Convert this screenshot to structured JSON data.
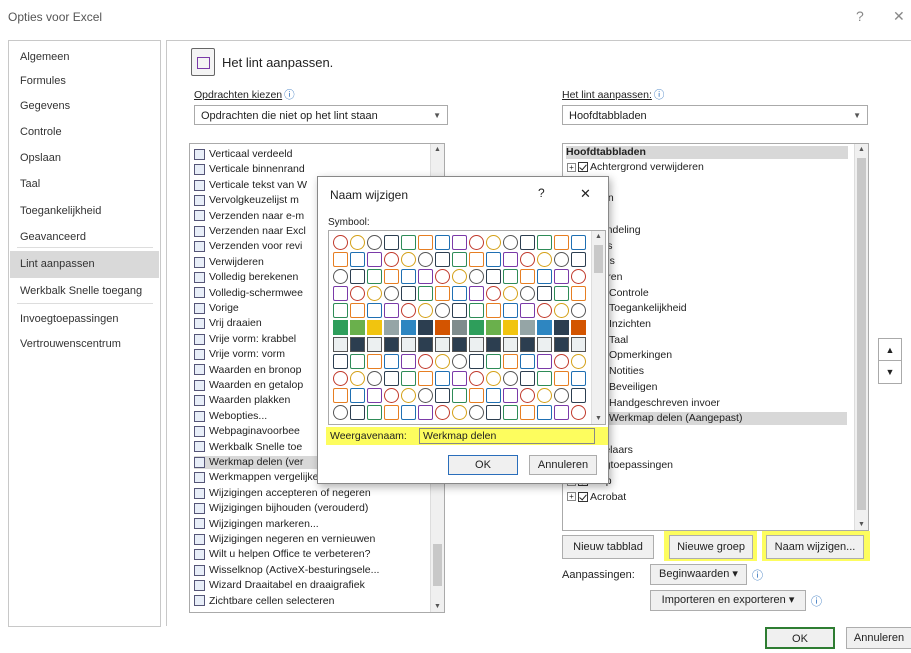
{
  "window": {
    "title": "Opties voor Excel",
    "help": "?",
    "close": "✕"
  },
  "nav": {
    "items": [
      "Algemeen",
      "Formules",
      "Gegevens",
      "Controle",
      "Opslaan",
      "Taal",
      "Toegankelijkheid",
      "Geavanceerd",
      "Lint aanpassen",
      "Werkbalk Snelle toegang",
      "Invoegtoepassingen",
      "Vertrouwenscentrum"
    ],
    "selected": "Lint aanpassen"
  },
  "header": {
    "title": "Het lint aanpassen."
  },
  "left": {
    "label": "Opdrachten kiezen",
    "dropdown_value": "Opdrachten die niet op het lint staan",
    "items": [
      "Verticaal verdeeld",
      "Verticale binnenrand",
      "Verticale tekst van W",
      "Vervolgkeuzelijst m",
      "Verzenden naar e-m",
      "Verzenden naar Excl",
      "Verzenden voor revi",
      "Verwijderen",
      "Volledig berekenen",
      "Volledig-schermwee",
      "Vorige",
      "Vrij draaien",
      "Vrije vorm: krabbel",
      "Vrije vorm: vorm",
      "Waarden en bronop",
      "Waarden en getalop",
      "Waarden plakken",
      "Webopties...",
      "Webpaginavoorbee",
      "Werkbalk Snelle toe",
      "Werkmap delen (ver",
      "Werkmappen vergelijken en samenv",
      "Wijzigingen accepteren of negeren",
      "Wijzigingen bijhouden (verouderd)",
      "Wijzigingen markeren...",
      "Wijzigingen negeren en vernieuwen",
      "Wilt u helpen Office te verbeteren?",
      "Wisselknop (ActiveX-besturingsele...",
      "Wizard Draaitabel en draaigrafiek",
      "Zichtbare cellen selecteren"
    ]
  },
  "right": {
    "label": "Het lint aanpassen:",
    "dropdown_value": "Hoofdtabbladen",
    "tree_header": "Hoofdtabbladen",
    "items": [
      {
        "text": "Achtergrond verwijderen",
        "level": 0,
        "pm": "⊞",
        "check": true
      },
      {
        "text": "rt",
        "level": 1
      },
      {
        "text": "roegen",
        "level": 1
      },
      {
        "text": "kenen",
        "level": 1
      },
      {
        "text": "gina-indeling",
        "level": 1
      },
      {
        "text": "rmules",
        "level": 1
      },
      {
        "text": "gevens",
        "level": 1
      },
      {
        "text": "ntroleren",
        "level": 1
      },
      {
        "text": "Controle",
        "level": 2
      },
      {
        "text": "Toegankelijkheid",
        "level": 2
      },
      {
        "text": "Inzichten",
        "level": 2
      },
      {
        "text": "Taal",
        "level": 2
      },
      {
        "text": "Opmerkingen",
        "level": 2
      },
      {
        "text": "Notities",
        "level": 2
      },
      {
        "text": "Beveiligen",
        "level": 2
      },
      {
        "text": "Handgeschreven invoer",
        "level": 2
      },
      {
        "text": "Werkmap delen (Aangepast)",
        "level": 2,
        "sel": true
      },
      {
        "text": "eld",
        "level": 1
      },
      {
        "text": "twikkelaars",
        "level": 1
      },
      {
        "text": "Invoegtoepassingen",
        "level": 0,
        "check": true
      },
      {
        "text": "Help",
        "level": 0,
        "pm": "⊞",
        "check": true
      },
      {
        "text": "Acrobat",
        "level": 0,
        "pm": "⊞",
        "check": true
      }
    ],
    "buttons": {
      "new_tab": "Nieuw tabblad",
      "new_group": "Nieuwe groep",
      "rename": "Naam wijzigen..."
    },
    "customizations_label": "Aanpassingen:",
    "reset_button": "Beginwaarden ▾",
    "import_export_button": "Importeren en exporteren ▾",
    "info_icon": "ⓘ"
  },
  "dialog": {
    "title": "Naam wijzigen",
    "help": "?",
    "close": "✕",
    "symbol_label": "Symbool:",
    "display_name_label": "Weergavenaam:",
    "display_name_value": "Werkmap delen",
    "ok": "OK",
    "cancel": "Annuleren"
  },
  "footer": {
    "ok": "OK",
    "cancel": "Annuleren"
  },
  "colors": {
    "highlight": "#fdfd5e",
    "selection": "#d9d9d9",
    "ok_border": "#2e7d32"
  }
}
